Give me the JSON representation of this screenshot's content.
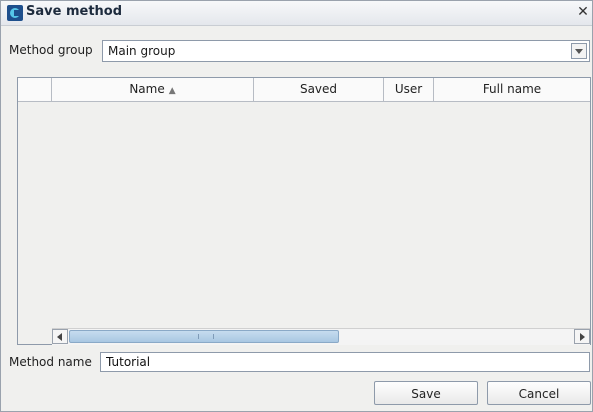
{
  "window": {
    "title": "Save method"
  },
  "method_group": {
    "label": "Method group",
    "value": "Main group"
  },
  "table": {
    "columns": [
      {
        "label": "Name",
        "sorted": "ascending"
      },
      {
        "label": "Saved"
      },
      {
        "label": "User"
      },
      {
        "label": "Full name"
      }
    ],
    "rows": []
  },
  "method_name": {
    "label": "Method name",
    "value": "Tutorial"
  },
  "buttons": {
    "save": "Save",
    "cancel": "Cancel"
  },
  "icons": {
    "sort": "sort-ascending-icon",
    "close": "close-icon",
    "dropdown": "chevron-down-icon"
  }
}
